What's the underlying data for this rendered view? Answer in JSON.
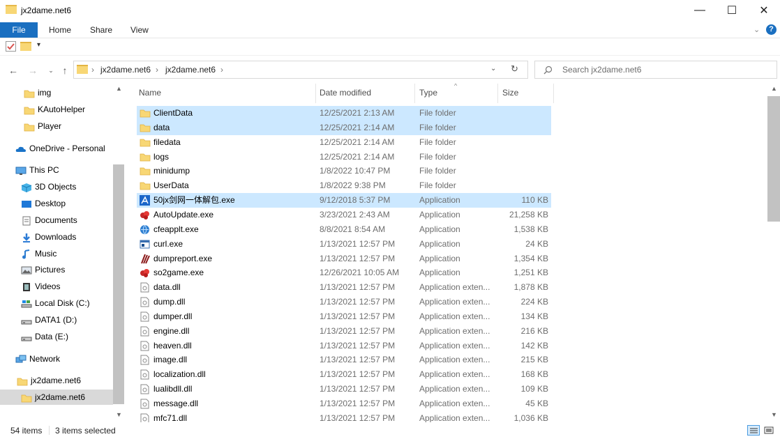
{
  "window": {
    "title": "jx2dame.net6",
    "minimize": "—",
    "maximize": "☐",
    "close": "✕"
  },
  "ribbon": {
    "tabs": [
      "File",
      "Home",
      "Share",
      "View"
    ],
    "help": "?"
  },
  "address": {
    "crumbs": [
      "jx2dame.net6",
      "jx2dame.net6"
    ],
    "search_placeholder": "Search jx2dame.net6"
  },
  "nav": [
    {
      "label": "img",
      "icon": "folder-icon"
    },
    {
      "label": "KAutoHelper",
      "icon": "folder-icon"
    },
    {
      "label": "Player",
      "icon": "folder-icon"
    },
    {
      "label": "OneDrive - Personal",
      "icon": "onedrive-icon"
    },
    {
      "label": "This PC",
      "icon": "pc-icon"
    },
    {
      "label": "3D Objects",
      "icon": "3d-objects-icon"
    },
    {
      "label": "Desktop",
      "icon": "desktop-icon"
    },
    {
      "label": "Documents",
      "icon": "documents-icon"
    },
    {
      "label": "Downloads",
      "icon": "downloads-icon"
    },
    {
      "label": "Music",
      "icon": "music-icon"
    },
    {
      "label": "Pictures",
      "icon": "pictures-icon"
    },
    {
      "label": "Videos",
      "icon": "videos-icon"
    },
    {
      "label": "Local Disk (C:)",
      "icon": "local-disk-icon"
    },
    {
      "label": "DATA1 (D:)",
      "icon": "drive-icon"
    },
    {
      "label": "Data (E:)",
      "icon": "drive-icon"
    },
    {
      "label": "Network",
      "icon": "network-icon"
    },
    {
      "label": "jx2dame.net6",
      "icon": "folder-icon"
    },
    {
      "label": "jx2dame.net6",
      "icon": "folder-icon"
    }
  ],
  "columns": {
    "name": "Name",
    "date": "Date modified",
    "type": "Type",
    "size": "Size"
  },
  "files": [
    {
      "name": "ClientData",
      "date": "12/25/2021 2:13 AM",
      "type": "File folder",
      "size": "",
      "icon": "folder-icon",
      "selected": true
    },
    {
      "name": "data",
      "date": "12/25/2021 2:14 AM",
      "type": "File folder",
      "size": "",
      "icon": "folder-icon",
      "selected": true
    },
    {
      "name": "filedata",
      "date": "12/25/2021 2:14 AM",
      "type": "File folder",
      "size": "",
      "icon": "folder-icon",
      "selected": false
    },
    {
      "name": "logs",
      "date": "12/25/2021 2:14 AM",
      "type": "File folder",
      "size": "",
      "icon": "folder-icon",
      "selected": false
    },
    {
      "name": "minidump",
      "date": "1/8/2022 10:47 PM",
      "type": "File folder",
      "size": "",
      "icon": "folder-icon",
      "selected": false
    },
    {
      "name": "UserData",
      "date": "1/8/2022 9:38 PM",
      "type": "File folder",
      "size": "",
      "icon": "folder-icon",
      "selected": false
    },
    {
      "name": "50jx剑网一体解包.exe",
      "date": "9/12/2018 5:37 PM",
      "type": "Application",
      "size": "110 KB",
      "icon": "app-blue-icon",
      "selected": true
    },
    {
      "name": "AutoUpdate.exe",
      "date": "3/23/2021 2:43 AM",
      "type": "Application",
      "size": "21,258 KB",
      "icon": "app-red-icon",
      "selected": false
    },
    {
      "name": "cfeapplt.exe",
      "date": "8/8/2021 8:54 AM",
      "type": "Application",
      "size": "1,538 KB",
      "icon": "globe-icon",
      "selected": false
    },
    {
      "name": "curl.exe",
      "date": "1/13/2021 12:57 PM",
      "type": "Application",
      "size": "24 KB",
      "icon": "window-app-icon",
      "selected": false
    },
    {
      "name": "dumpreport.exe",
      "date": "1/13/2021 12:57 PM",
      "type": "Application",
      "size": "1,354 KB",
      "icon": "claw-icon",
      "selected": false
    },
    {
      "name": "so2game.exe",
      "date": "12/26/2021 10:05 AM",
      "type": "Application",
      "size": "1,251 KB",
      "icon": "app-red-icon",
      "selected": false
    },
    {
      "name": "data.dll",
      "date": "1/13/2021 12:57 PM",
      "type": "Application exten...",
      "size": "1,878 KB",
      "icon": "dll-icon",
      "selected": false
    },
    {
      "name": "dump.dll",
      "date": "1/13/2021 12:57 PM",
      "type": "Application exten...",
      "size": "224 KB",
      "icon": "dll-icon",
      "selected": false
    },
    {
      "name": "dumper.dll",
      "date": "1/13/2021 12:57 PM",
      "type": "Application exten...",
      "size": "134 KB",
      "icon": "dll-icon",
      "selected": false
    },
    {
      "name": "engine.dll",
      "date": "1/13/2021 12:57 PM",
      "type": "Application exten...",
      "size": "216 KB",
      "icon": "dll-icon",
      "selected": false
    },
    {
      "name": "heaven.dll",
      "date": "1/13/2021 12:57 PM",
      "type": "Application exten...",
      "size": "142 KB",
      "icon": "dll-icon",
      "selected": false
    },
    {
      "name": "image.dll",
      "date": "1/13/2021 12:57 PM",
      "type": "Application exten...",
      "size": "215 KB",
      "icon": "dll-icon",
      "selected": false
    },
    {
      "name": "localization.dll",
      "date": "1/13/2021 12:57 PM",
      "type": "Application exten...",
      "size": "168 KB",
      "icon": "dll-icon",
      "selected": false
    },
    {
      "name": "lualibdll.dll",
      "date": "1/13/2021 12:57 PM",
      "type": "Application exten...",
      "size": "109 KB",
      "icon": "dll-icon",
      "selected": false
    },
    {
      "name": "message.dll",
      "date": "1/13/2021 12:57 PM",
      "type": "Application exten...",
      "size": "45 KB",
      "icon": "dll-icon",
      "selected": false
    },
    {
      "name": "mfc71.dll",
      "date": "1/13/2021 12:57 PM",
      "type": "Application exten...",
      "size": "1,036 KB",
      "icon": "dll-icon",
      "selected": false
    }
  ],
  "status": {
    "items": "54 items",
    "selected": "3 items selected"
  },
  "colors": {
    "accent": "#1a6fc0",
    "selection": "#cce8ff",
    "folder": "#f8d775"
  }
}
